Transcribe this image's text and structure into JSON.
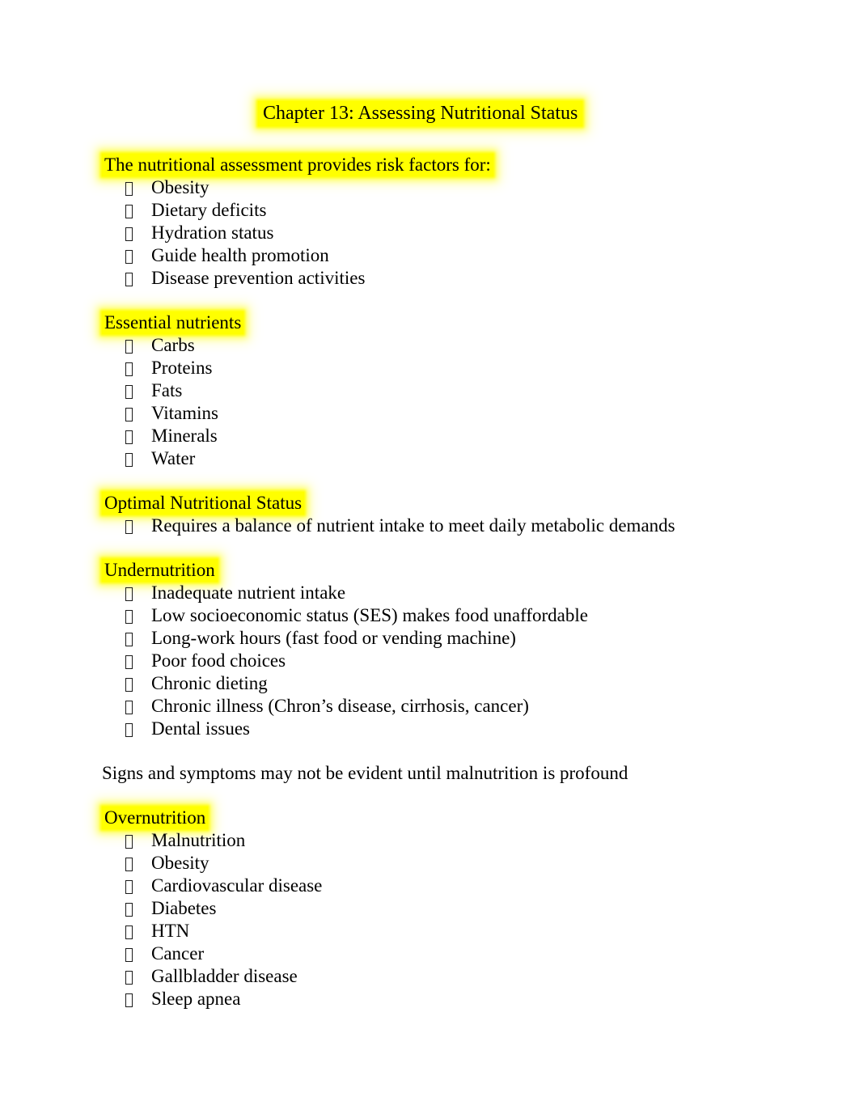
{
  "document": {
    "title": "Chapter 13: Assessing Nutritional Status",
    "highlight_color": "#ffff00",
    "text_color": "#000000",
    "background_color": "#ffffff",
    "bullet_glyph": "missing-glyph-box"
  },
  "sections": [
    {
      "heading": "The nutritional assessment provides risk factors for:",
      "highlighted": true,
      "items": [
        "Obesity",
        "Dietary deficits",
        "Hydration status",
        "Guide health promotion",
        "Disease prevention activities"
      ]
    },
    {
      "heading": "Essential nutrients",
      "highlighted": true,
      "items": [
        "Carbs",
        "Proteins",
        "Fats",
        "Vitamins",
        "Minerals",
        "Water"
      ]
    },
    {
      "heading": "Optimal Nutritional Status",
      "highlighted": true,
      "items": [
        "Requires a balance of nutrient intake to meet daily metabolic demands"
      ]
    },
    {
      "heading": "Undernutrition",
      "highlighted": true,
      "items": [
        "Inadequate nutrient intake",
        "Low socioeconomic status (SES) makes food unaffordable",
        "Long-work hours (fast food or vending machine)",
        "Poor food choices",
        "Chronic dieting",
        "Chronic illness (Chron’s disease, cirrhosis, cancer)",
        "Dental issues"
      ]
    },
    {
      "heading": "Overnutrition",
      "highlighted": true,
      "items": [
        "Malnutrition",
        "Obesity",
        "Cardiovascular disease",
        "Diabetes",
        "HTN",
        "Cancer",
        "Gallbladder disease",
        "Sleep apnea"
      ]
    }
  ],
  "standalone_paragraph": "Signs and symptoms may not be evident until malnutrition is profound"
}
